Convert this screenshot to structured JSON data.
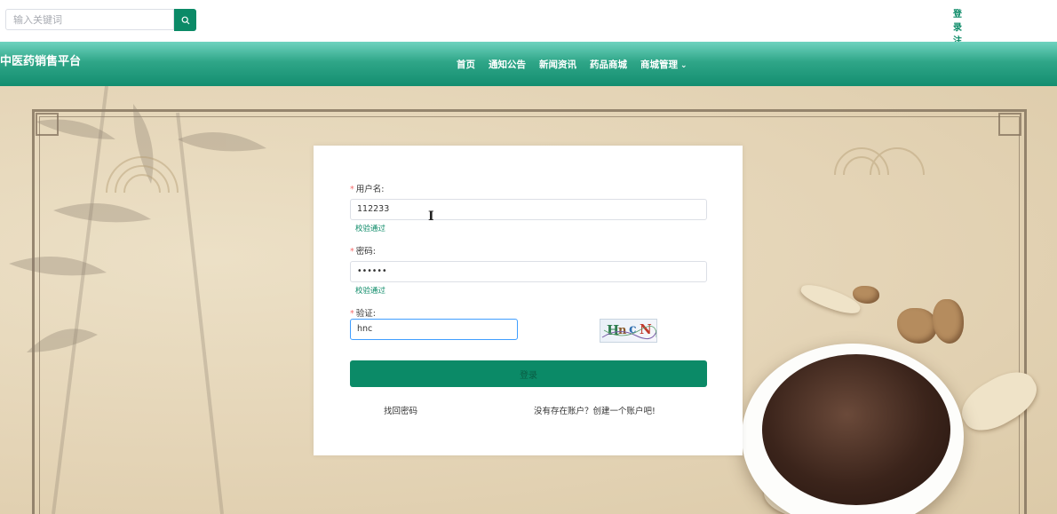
{
  "header": {
    "search": {
      "placeholder": "输入关键词",
      "value": ""
    },
    "search_icon": "search-icon",
    "login": "登 录",
    "register": "注 册",
    "login_chars": [
      "登",
      "录"
    ],
    "register_chars": [
      "注",
      "册"
    ]
  },
  "nav": {
    "brand": "中医药销售平台",
    "items": [
      {
        "label": "首页"
      },
      {
        "label": "通知公告"
      },
      {
        "label": "新闻资讯"
      },
      {
        "label": "药品商城"
      },
      {
        "label": "商城管理",
        "has_dropdown": true
      }
    ]
  },
  "login_form": {
    "username": {
      "label": "用户名:",
      "value": "112233",
      "status": "校验通过"
    },
    "password": {
      "label": "密码:",
      "value": "••••••",
      "status": "校验通过"
    },
    "captcha": {
      "label": "验证:",
      "value": "hnc",
      "image_text": "HncN"
    },
    "submit_label": "登录",
    "forgot_link": "找回密码",
    "register_link": "没有存在账户？创建一个账户吧!"
  },
  "colors": {
    "primary": "#0b8a67",
    "nav_gradient_top": "#6fd3bf",
    "nav_gradient_bottom": "#148e70",
    "error": "#f56c6c"
  }
}
